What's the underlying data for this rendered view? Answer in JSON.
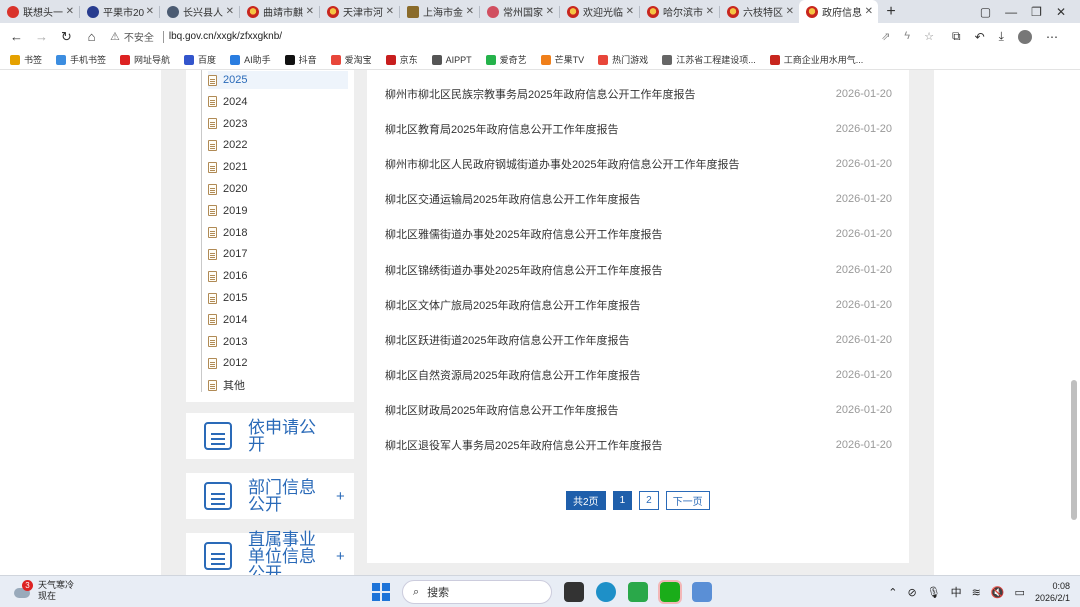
{
  "tabs": [
    {
      "title": "联想头一",
      "icon": "news-icon"
    },
    {
      "title": "平果市20",
      "icon": "star-emblem-icon"
    },
    {
      "title": "长兴县人",
      "icon": "gear-icon"
    },
    {
      "title": "曲靖市麒",
      "icon": "emblem-icon"
    },
    {
      "title": "天津市河",
      "icon": "emblem-icon"
    },
    {
      "title": "上海市金",
      "icon": "mountain-icon"
    },
    {
      "title": "常州国家",
      "icon": "flower-icon"
    },
    {
      "title": "欢迎光临",
      "icon": "emblem-icon"
    },
    {
      "title": "哈尔滨市",
      "icon": "emblem-icon"
    },
    {
      "title": "六枝特区",
      "icon": "emblem-icon"
    },
    {
      "title": "政府信息",
      "icon": "emblem-icon",
      "active": true
    }
  ],
  "address": {
    "security_label": "不安全",
    "url": "lbq.gov.cn/xxgk/zfxxgknb/"
  },
  "bookmarks": [
    "书签",
    "手机书签",
    "网址导航",
    "百度",
    "AI助手",
    "抖音",
    "爱淘宝",
    "京东",
    "AIPPT",
    "爱奇艺",
    "芒果TV",
    "热门游戏",
    "江苏省工程建设项...",
    "工商企业用水用气..."
  ],
  "years": [
    "2025",
    "2024",
    "2023",
    "2022",
    "2021",
    "2020",
    "2019",
    "2018",
    "2017",
    "2016",
    "2015",
    "2014",
    "2013",
    "2012",
    "其他"
  ],
  "active_year": "2025",
  "side_boxes": [
    {
      "label": "依申请公开",
      "has_plus": false
    },
    {
      "label": "部门信息公开",
      "has_plus": true,
      "plus": "+"
    },
    {
      "label": "直属事业单位信息公开",
      "has_plus": true,
      "plus": "+"
    }
  ],
  "reports": [
    {
      "title": "柳州市柳北区民族宗教事务局2025年政府信息公开工作年度报告",
      "date": "2026-01-20"
    },
    {
      "title": "柳北区教育局2025年政府信息公开工作年度报告",
      "date": "2026-01-20"
    },
    {
      "title": "柳州市柳北区人民政府钢城街道办事处2025年政府信息公开工作年度报告",
      "date": "2026-01-20"
    },
    {
      "title": "柳北区交通运输局2025年政府信息公开工作年度报告",
      "date": "2026-01-20"
    },
    {
      "title": "柳北区雅儒街道办事处2025年政府信息公开工作年度报告",
      "date": "2026-01-20"
    },
    {
      "title": "柳北区锦绣街道办事处2025年政府信息公开工作年度报告",
      "date": "2026-01-20"
    },
    {
      "title": "柳北区文体广旅局2025年政府信息公开工作年度报告",
      "date": "2026-01-20"
    },
    {
      "title": "柳北区跃进街道2025年政府信息公开工作年度报告",
      "date": "2026-01-20"
    },
    {
      "title": "柳北区自然资源局2025年政府信息公开工作年度报告",
      "date": "2026-01-20"
    },
    {
      "title": "柳北区财政局2025年政府信息公开工作年度报告",
      "date": "2026-01-20"
    },
    {
      "title": "柳北区退役军人事务局2025年政府信息公开工作年度报告",
      "date": "2026-01-20"
    }
  ],
  "pagination": {
    "total": "共2页",
    "page1": "1",
    "page2": "2",
    "next": "下一页",
    "current": 1
  },
  "taskbar": {
    "weather_text": "天气寒冷",
    "weather_sub": "现在",
    "weather_badge": "3",
    "search_placeholder": "搜索",
    "ime": "中",
    "time": "0:08",
    "date": "2026/2/1"
  },
  "colors": {
    "accent": "#2a6ab8",
    "pager_fill": "#1f5fab",
    "date": "#999999"
  }
}
